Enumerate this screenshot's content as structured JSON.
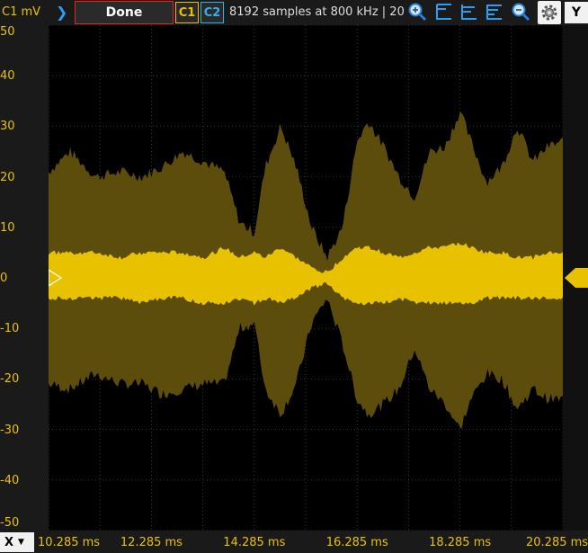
{
  "toolbar": {
    "channel_unit": "C1 mV",
    "status": "Done",
    "ch1_label": "C1",
    "ch2_label": "C2",
    "acquisition_info": "8192 samples at 800 kHz | 20",
    "y_button": "Y",
    "icons": [
      "run-arrow-icon",
      "zoom-in-icon",
      "align-top-icon",
      "align-middle-icon",
      "align-bottom-icon",
      "zoom-out-icon",
      "gear-icon"
    ]
  },
  "bottom": {
    "x_button": "X"
  },
  "colors": {
    "trace": "#e8c200",
    "envelope": "#5c4d0c",
    "channel2": "#2fb4e8",
    "status_border": "#e0261e"
  },
  "chart_data": {
    "type": "area",
    "ylim": [
      -50,
      50
    ],
    "xlim": [
      10.285,
      20.285
    ],
    "y_ticks": [
      "50",
      "40",
      "30",
      "20",
      "10",
      "0",
      "-10",
      "-20",
      "-30",
      "-40",
      "-50"
    ],
    "x_ticks": [
      "10.285 ms",
      "12.285 ms",
      "14.285 ms",
      "16.285 ms",
      "18.285 ms",
      "20.285 ms"
    ],
    "x_tick_values": [
      10.285,
      12.285,
      14.285,
      16.285,
      18.285,
      20.285
    ],
    "grid": true,
    "trigger_level": 0,
    "x": [
      10.285,
      10.7,
      11.2,
      11.7,
      12.1,
      12.5,
      12.9,
      13.3,
      13.7,
      14.0,
      14.285,
      14.5,
      14.8,
      15.1,
      15.4,
      15.7,
      16.0,
      16.285,
      16.5,
      16.8,
      17.1,
      17.4,
      17.7,
      18.0,
      18.285,
      18.5,
      18.8,
      19.1,
      19.4,
      19.7,
      20.0,
      20.285
    ],
    "series": [
      {
        "values_max": [
          21,
          25,
          20,
          21,
          20,
          22,
          25,
          23,
          21,
          11,
          9,
          22,
          30,
          22,
          10,
          4,
          10,
          27,
          31,
          26,
          20,
          16,
          25,
          26,
          33,
          27,
          19,
          22,
          30,
          23,
          26,
          27
        ],
        "values_min": [
          -21,
          -22,
          -19,
          -21,
          -21,
          -23,
          -22,
          -21,
          -21,
          -10,
          -9,
          -22,
          -27,
          -21,
          -9,
          -4,
          -13,
          -24,
          -27,
          -25,
          -22,
          -14,
          -22,
          -25,
          -30,
          -24,
          -19,
          -20,
          -26,
          -22,
          -24,
          -24
        ]
      },
      {
        "values_max": [
          5,
          5,
          5,
          4,
          5,
          5,
          5,
          4,
          6,
          4,
          5,
          4,
          6,
          4,
          2,
          1,
          4,
          6,
          6,
          5,
          4,
          5,
          6,
          6,
          7,
          6,
          5,
          5,
          4,
          4,
          5,
          5
        ],
        "values_min": [
          -4,
          -4,
          -4,
          -4,
          -5,
          -4,
          -4,
          -5,
          -5,
          -4,
          -5,
          -4,
          -5,
          -4,
          -2,
          -1,
          -4,
          -5,
          -5,
          -5,
          -4,
          -5,
          -5,
          -5,
          -5,
          -5,
          -4,
          -4,
          -4,
          -4,
          -4,
          -4
        ]
      }
    ]
  }
}
